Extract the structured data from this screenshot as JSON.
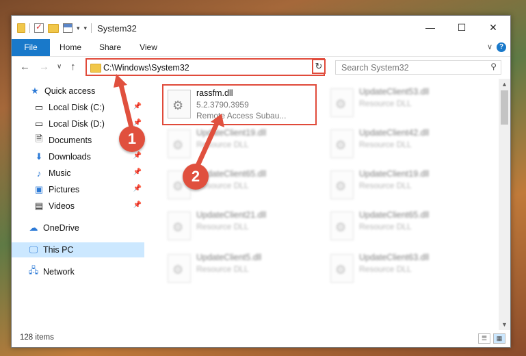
{
  "window": {
    "title": "System32"
  },
  "ribbon": {
    "tabs": [
      "File",
      "Home",
      "Share",
      "View"
    ]
  },
  "controls": {
    "minimize": "—",
    "maximize": "☐",
    "close": "✕"
  },
  "navbar": {
    "path": "C:\\Windows\\System32",
    "search_placeholder": "Search System32"
  },
  "sidebar": {
    "items": [
      {
        "label": "Quick access",
        "icon": "star-icon",
        "pinned": false
      },
      {
        "label": "Local Disk (C:)",
        "icon": "drive-icon",
        "pinned": true
      },
      {
        "label": "Local Disk (D:)",
        "icon": "drive-icon",
        "pinned": true
      },
      {
        "label": "Documents",
        "icon": "document-icon",
        "pinned": true
      },
      {
        "label": "Downloads",
        "icon": "download-icon",
        "pinned": true
      },
      {
        "label": "Music",
        "icon": "music-icon",
        "pinned": true
      },
      {
        "label": "Pictures",
        "icon": "pictures-icon",
        "pinned": true
      },
      {
        "label": "Videos",
        "icon": "video-icon",
        "pinned": true
      },
      {
        "label": "OneDrive",
        "icon": "cloud-icon",
        "pinned": false
      },
      {
        "label": "This PC",
        "icon": "computer-icon",
        "pinned": false,
        "selected": true
      },
      {
        "label": "Network",
        "icon": "network-icon",
        "pinned": false
      }
    ]
  },
  "files": [
    {
      "name": "rassfm.dll",
      "line1": "5.2.3790.3959",
      "line2": "Remote Access Subau...",
      "highlighted": true
    },
    {
      "name": "UpdateClient53.dll",
      "line1": "Resource DLL"
    },
    {
      "name": "UpdateClient19.dll",
      "line1": "Resource DLL"
    },
    {
      "name": "UpdateClient42.dll",
      "line1": "Resource DLL"
    },
    {
      "name": "UpdateClient65.dll",
      "line1": "Resource DLL"
    },
    {
      "name": "UpdateClient19.dll",
      "line1": "Resource DLL"
    },
    {
      "name": "UpdateClient21.dll",
      "line1": "Resource DLL"
    },
    {
      "name": "UpdateClient65.dll",
      "line1": "Resource DLL"
    },
    {
      "name": "UpdateClient5.dll",
      "line1": "Resource DLL"
    },
    {
      "name": "UpdateClient63.dll",
      "line1": "Resource DLL"
    }
  ],
  "status": {
    "item_count": "128 items"
  },
  "markers": [
    "1",
    "2"
  ],
  "colors": {
    "accent": "#1979ca",
    "highlight": "#e04a3a",
    "selected": "#cce8ff"
  }
}
